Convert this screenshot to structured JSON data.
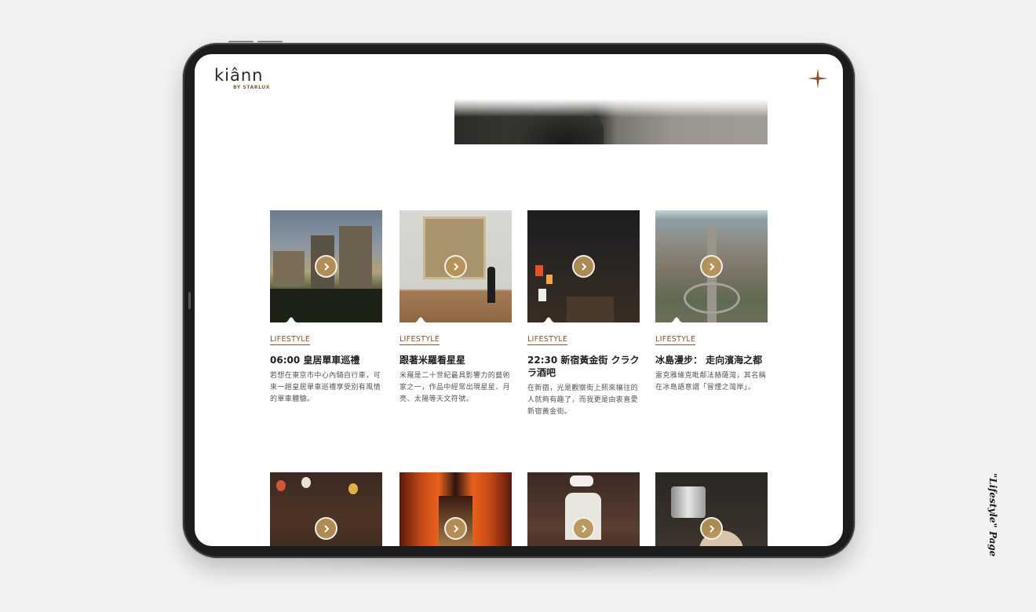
{
  "brand": {
    "name": "kiânn",
    "sub": "BY STARLUX",
    "accent": "#8b5232",
    "gold": "#b69258"
  },
  "header": {
    "menu_icon": "four-point-star-icon"
  },
  "cards_row1": [
    {
      "tag": "LIFESTYLE",
      "title": "06:00 皇居單車巡禮",
      "desc": "若想在東京市中心內騎自行車，可來一趟皇居單車巡禮享受別有風情的單車體驗。"
    },
    {
      "tag": "LIFESTYLE",
      "title": "跟著米羅看星星",
      "desc": "米羅是二十世紀最具影響力的藝術家之一，作品中經常出現星星、月亮、太陽等天文符號。"
    },
    {
      "tag": "LIFESTYLE",
      "title": "22:30 新宿黃金街 クラクラ酒吧",
      "desc": "在新宿，光是觀察街上熙來攘往的人就夠有趣了，而我更是由衷喜愛新宿黃金街。"
    },
    {
      "tag": "LIFESTYLE",
      "title": "冰島漫步： 走向濱海之都",
      "desc": "雷克雅維克毗鄰法赫薩灣，其名稱在冰島語意謂「冒煙之灣岸」。"
    }
  ],
  "caption": "\"Lifestyle\" Page"
}
